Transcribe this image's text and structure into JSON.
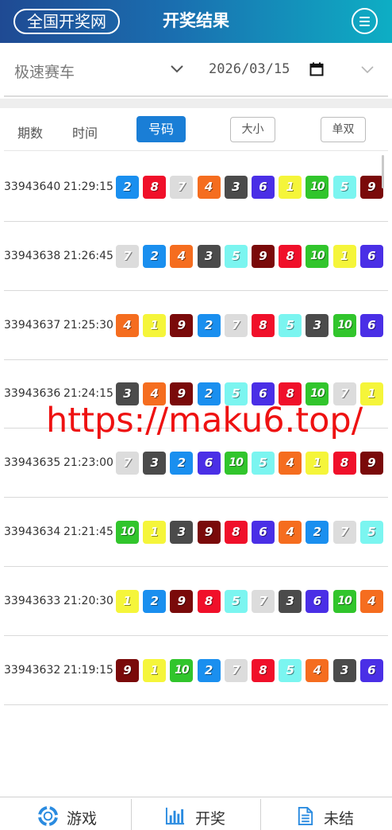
{
  "header": {
    "brand": "全国开奖网",
    "title": "开奖结果"
  },
  "filter": {
    "game": "极速赛车",
    "date": "2026/03/15"
  },
  "tabs": {
    "period": "期数",
    "time": "时间",
    "number": "号码",
    "big_small": "大小",
    "odd_even": "单双"
  },
  "ball_colors": {
    "1": "#f5f53a",
    "2": "#1a8fef",
    "3": "#4b4b4b",
    "4": "#f56d1f",
    "5": "#7bf5f0",
    "6": "#4a2fe6",
    "7": "#dcdcdc",
    "8": "#f0102a",
    "9": "#7a0a0a",
    "10": "#31c52c"
  },
  "results": [
    {
      "period": "33943640",
      "time": "21:29:15",
      "numbers": [
        "2",
        "8",
        "7",
        "4",
        "3",
        "6",
        "1",
        "10",
        "5",
        "9"
      ]
    },
    {
      "period": "33943638",
      "time": "21:26:45",
      "numbers": [
        "7",
        "2",
        "4",
        "3",
        "5",
        "9",
        "8",
        "10",
        "1",
        "6"
      ]
    },
    {
      "period": "33943637",
      "time": "21:25:30",
      "numbers": [
        "4",
        "1",
        "9",
        "2",
        "7",
        "8",
        "5",
        "3",
        "10",
        "6"
      ]
    },
    {
      "period": "33943636",
      "time": "21:24:15",
      "numbers": [
        "3",
        "4",
        "9",
        "2",
        "5",
        "6",
        "8",
        "10",
        "7",
        "1"
      ]
    },
    {
      "period": "33943635",
      "time": "21:23:00",
      "numbers": [
        "7",
        "3",
        "2",
        "6",
        "10",
        "5",
        "4",
        "1",
        "8",
        "9"
      ]
    },
    {
      "period": "33943634",
      "time": "21:21:45",
      "numbers": [
        "10",
        "1",
        "3",
        "9",
        "8",
        "6",
        "4",
        "2",
        "7",
        "5"
      ]
    },
    {
      "period": "33943633",
      "time": "21:20:30",
      "numbers": [
        "1",
        "2",
        "9",
        "8",
        "5",
        "7",
        "3",
        "6",
        "10",
        "4"
      ]
    },
    {
      "period": "33943632",
      "time": "21:19:15",
      "numbers": [
        "9",
        "1",
        "10",
        "2",
        "7",
        "8",
        "5",
        "4",
        "3",
        "6"
      ]
    }
  ],
  "watermark": "https://maku6.top/",
  "footer": {
    "games": "游戏",
    "results": "开奖",
    "unsettled": "未结"
  },
  "icons": {
    "menu": "menu-icon",
    "chevron": "chevron-down-icon",
    "calendar": "calendar-icon",
    "games": "lifebuoy-icon",
    "results": "bar-chart-icon",
    "unsettled": "document-icon"
  }
}
